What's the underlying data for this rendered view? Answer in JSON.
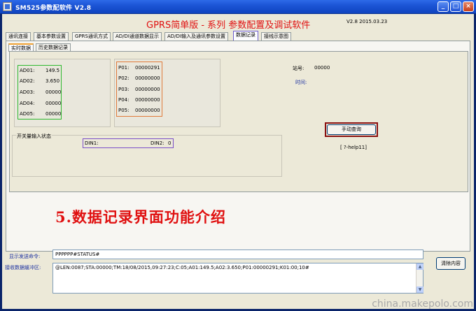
{
  "window": {
    "title": "SM525参数配软件  V2.8",
    "minimize": "_",
    "maximize": "□",
    "close": "×"
  },
  "header": {
    "title": "GPRS简单版 - 系列 参数配置及调试软件",
    "version": "V2.8 2015.03.23"
  },
  "tabs": [
    {
      "label": "通讯连接"
    },
    {
      "label": "基本参数设置"
    },
    {
      "label": "GPRS通讯方式"
    },
    {
      "label": "AD/DI通道数据显示"
    },
    {
      "label": "AD/DI输入及通讯参数设置"
    },
    {
      "label": "数据记录"
    },
    {
      "label": "接线示意图"
    }
  ],
  "subtabs": [
    {
      "label": "实时数据"
    },
    {
      "label": "历史数据记录"
    }
  ],
  "ad": [
    {
      "label": "AD01:",
      "value": "149.5"
    },
    {
      "label": "AD02:",
      "value": "3.650"
    },
    {
      "label": "AD03:",
      "value": "00000"
    },
    {
      "label": "AD04:",
      "value": "00000"
    },
    {
      "label": "AD05:",
      "value": "00000"
    }
  ],
  "pulse": [
    {
      "label": "P01:",
      "value": "00000291"
    },
    {
      "label": "P02:",
      "value": "00000000"
    },
    {
      "label": "P03:",
      "value": "00000000"
    },
    {
      "label": "P04:",
      "value": "00000000"
    },
    {
      "label": "P05:",
      "value": "00000000"
    }
  ],
  "station": {
    "label": "站号:",
    "value": "00000"
  },
  "time": {
    "label": "时间:",
    "value": ""
  },
  "manual_query": "手动查询",
  "help": "[ ?-help11]",
  "switch_input": {
    "title": "开关量输入状态",
    "din1_label": "DIN1:",
    "din1_value": "",
    "din2_label": "DIN2:",
    "din2_value": "0"
  },
  "caption": "5.数据记录界面功能介绍",
  "send": {
    "label": "显示发送命令:",
    "value": "PPPPPP#STATUS#"
  },
  "receive": {
    "label": "接收数据缓冲区:",
    "value": "@LEN:0087;STA:00000;TM:18/08/2015,09:27:23;C:05;A01:149.5;A02:3.650;P01:00000291;K01:00;10#"
  },
  "clear_button": "清除内容",
  "watermark": "china.makepolo.com"
}
